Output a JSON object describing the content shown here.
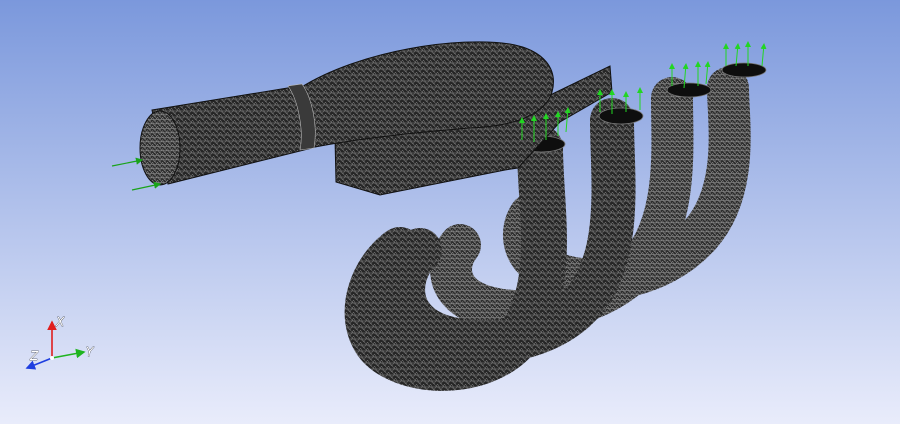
{
  "viewport": {
    "background_top": "#7b98dc",
    "background_bottom": "#e9ecfb",
    "mesh_color": "#2b2b2b",
    "mesh_line_color": "#9a9a9a",
    "inlet_arrow_color": "#1aa31a",
    "outlet_arrow_color": "#22d622"
  },
  "triad": {
    "x_label": "X",
    "y_label": "Y",
    "z_label": "Z",
    "x_color": "#e01e1e",
    "y_color": "#1fb41f",
    "z_color": "#1e3ee0"
  }
}
